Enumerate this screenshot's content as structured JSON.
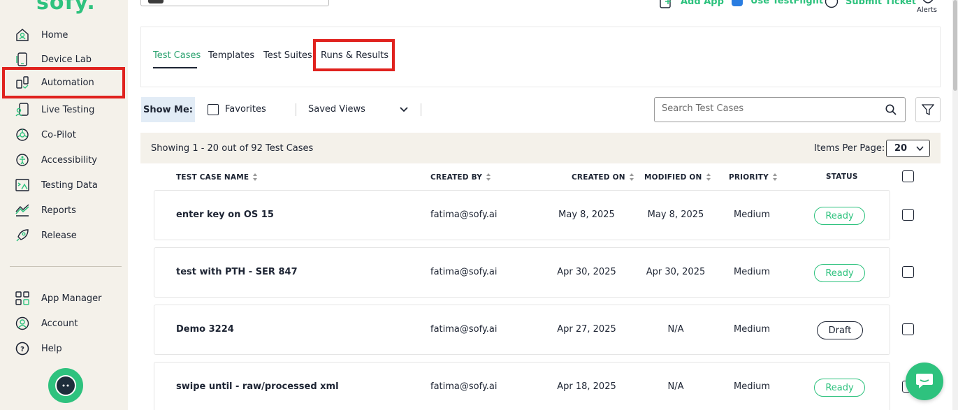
{
  "app": {
    "logo_text": "sofy."
  },
  "sidebar": {
    "items": [
      {
        "label": "Home",
        "icon": "home-icon"
      },
      {
        "label": "Device Lab",
        "icon": "phone-icon"
      },
      {
        "label": "Automation",
        "icon": "automation-icon"
      },
      {
        "label": "Live Testing",
        "icon": "live-testing-icon"
      },
      {
        "label": "Co-Pilot",
        "icon": "copilot-icon"
      },
      {
        "label": "Accessibility",
        "icon": "accessibility-icon"
      },
      {
        "label": "Testing Data",
        "icon": "testing-data-icon"
      },
      {
        "label": "Reports",
        "icon": "reports-icon"
      },
      {
        "label": "Release",
        "icon": "rocket-icon"
      }
    ],
    "bottom_items": [
      {
        "label": "App Manager",
        "icon": "app-manager-icon"
      },
      {
        "label": "Account",
        "icon": "account-icon"
      },
      {
        "label": "Help",
        "icon": "help-icon"
      }
    ]
  },
  "header": {
    "actions": [
      "Add App",
      "Use TestFlight",
      "Submit Ticket"
    ],
    "alerts_label": "Alerts"
  },
  "tabs": [
    "Test Cases",
    "Templates",
    "Test Suites",
    "Runs & Results"
  ],
  "filters": {
    "show_me": "Show Me:",
    "favorites": "Favorites",
    "saved_views": "Saved Views",
    "search_placeholder": "Search Test Cases"
  },
  "table": {
    "showing": "Showing 1 - 20 out of 92 Test Cases",
    "items_per_page_label": "Items Per Page:",
    "items_per_page": "20",
    "columns": [
      "TEST CASE NAME",
      "CREATED BY",
      "CREATED ON",
      "MODIFIED ON",
      "PRIORITY",
      "STATUS"
    ],
    "rows": [
      {
        "name": "enter key on OS 15",
        "created_by": "fatima@sofy.ai",
        "created_on": "May 8, 2025",
        "modified_on": "May 8, 2025",
        "priority": "Medium",
        "status": "Ready"
      },
      {
        "name": "test with PTH - SER 847",
        "created_by": "fatima@sofy.ai",
        "created_on": "Apr 30, 2025",
        "modified_on": "Apr 30, 2025",
        "priority": "Medium",
        "status": "Ready"
      },
      {
        "name": "Demo 3224",
        "created_by": "fatima@sofy.ai",
        "created_on": "Apr 27, 2025",
        "modified_on": "N/A",
        "priority": "Medium",
        "status": "Draft"
      },
      {
        "name": "swipe until - raw/processed xml",
        "created_by": "fatima@sofy.ai",
        "created_on": "Apr 18, 2025",
        "modified_on": "N/A",
        "priority": "Medium",
        "status": "Ready"
      }
    ]
  },
  "colors": {
    "accent": "#2ec27e",
    "highlight": "#e0221e",
    "sidebar_bg": "#f4f1ea"
  }
}
